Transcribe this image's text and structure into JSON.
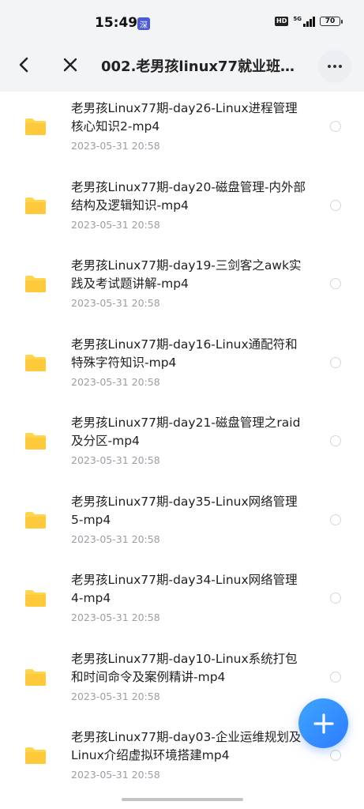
{
  "status_bar": {
    "time": "15:49",
    "app_badge": "深",
    "hd": "HD",
    "network": "5G",
    "battery": "70"
  },
  "nav": {
    "title": "002.老男孩linux77就业班基…",
    "back_icon": "chevron-left-icon",
    "close_icon": "close-icon",
    "more_icon": "more-icon"
  },
  "colors": {
    "folder": "#FFD54F",
    "accent": "#2E7BFF",
    "date": "#9A9EA5"
  },
  "files": [
    {
      "name": "老男孩Linux77期-day26-Linux进程管理核心知识2-mp4",
      "date": "2023-05-31  20:58"
    },
    {
      "name": "老男孩Linux77期-day20-磁盘管理-内外部结构及逻辑知识-mp4",
      "date": "2023-05-31  20:58"
    },
    {
      "name": "老男孩Linux77期-day19-三剑客之awk实践及考试题讲解-mp4",
      "date": "2023-05-31  20:58"
    },
    {
      "name": "老男孩Linux77期-day16-Linux通配符和特殊字符知识-mp4",
      "date": "2023-05-31  20:58"
    },
    {
      "name": "老男孩Linux77期-day21-磁盘管理之raid及分区-mp4",
      "date": "2023-05-31  20:58"
    },
    {
      "name": "老男孩Linux77期-day35-Linux网络管理5-mp4",
      "date": "2023-05-31  20:58"
    },
    {
      "name": "老男孩Linux77期-day34-Linux网络管理4-mp4",
      "date": "2023-05-31  20:58"
    },
    {
      "name": "老男孩Linux77期-day10-Linux系统打包和时间命令及案例精讲-mp4",
      "date": "2023-05-31  20:58"
    },
    {
      "name": "老男孩Linux77期-day03-企业运维规划及Linux介绍虚拟环境搭建mp4",
      "date": "2023-05-31  20:58"
    }
  ],
  "fab": {
    "icon": "plus-icon"
  }
}
